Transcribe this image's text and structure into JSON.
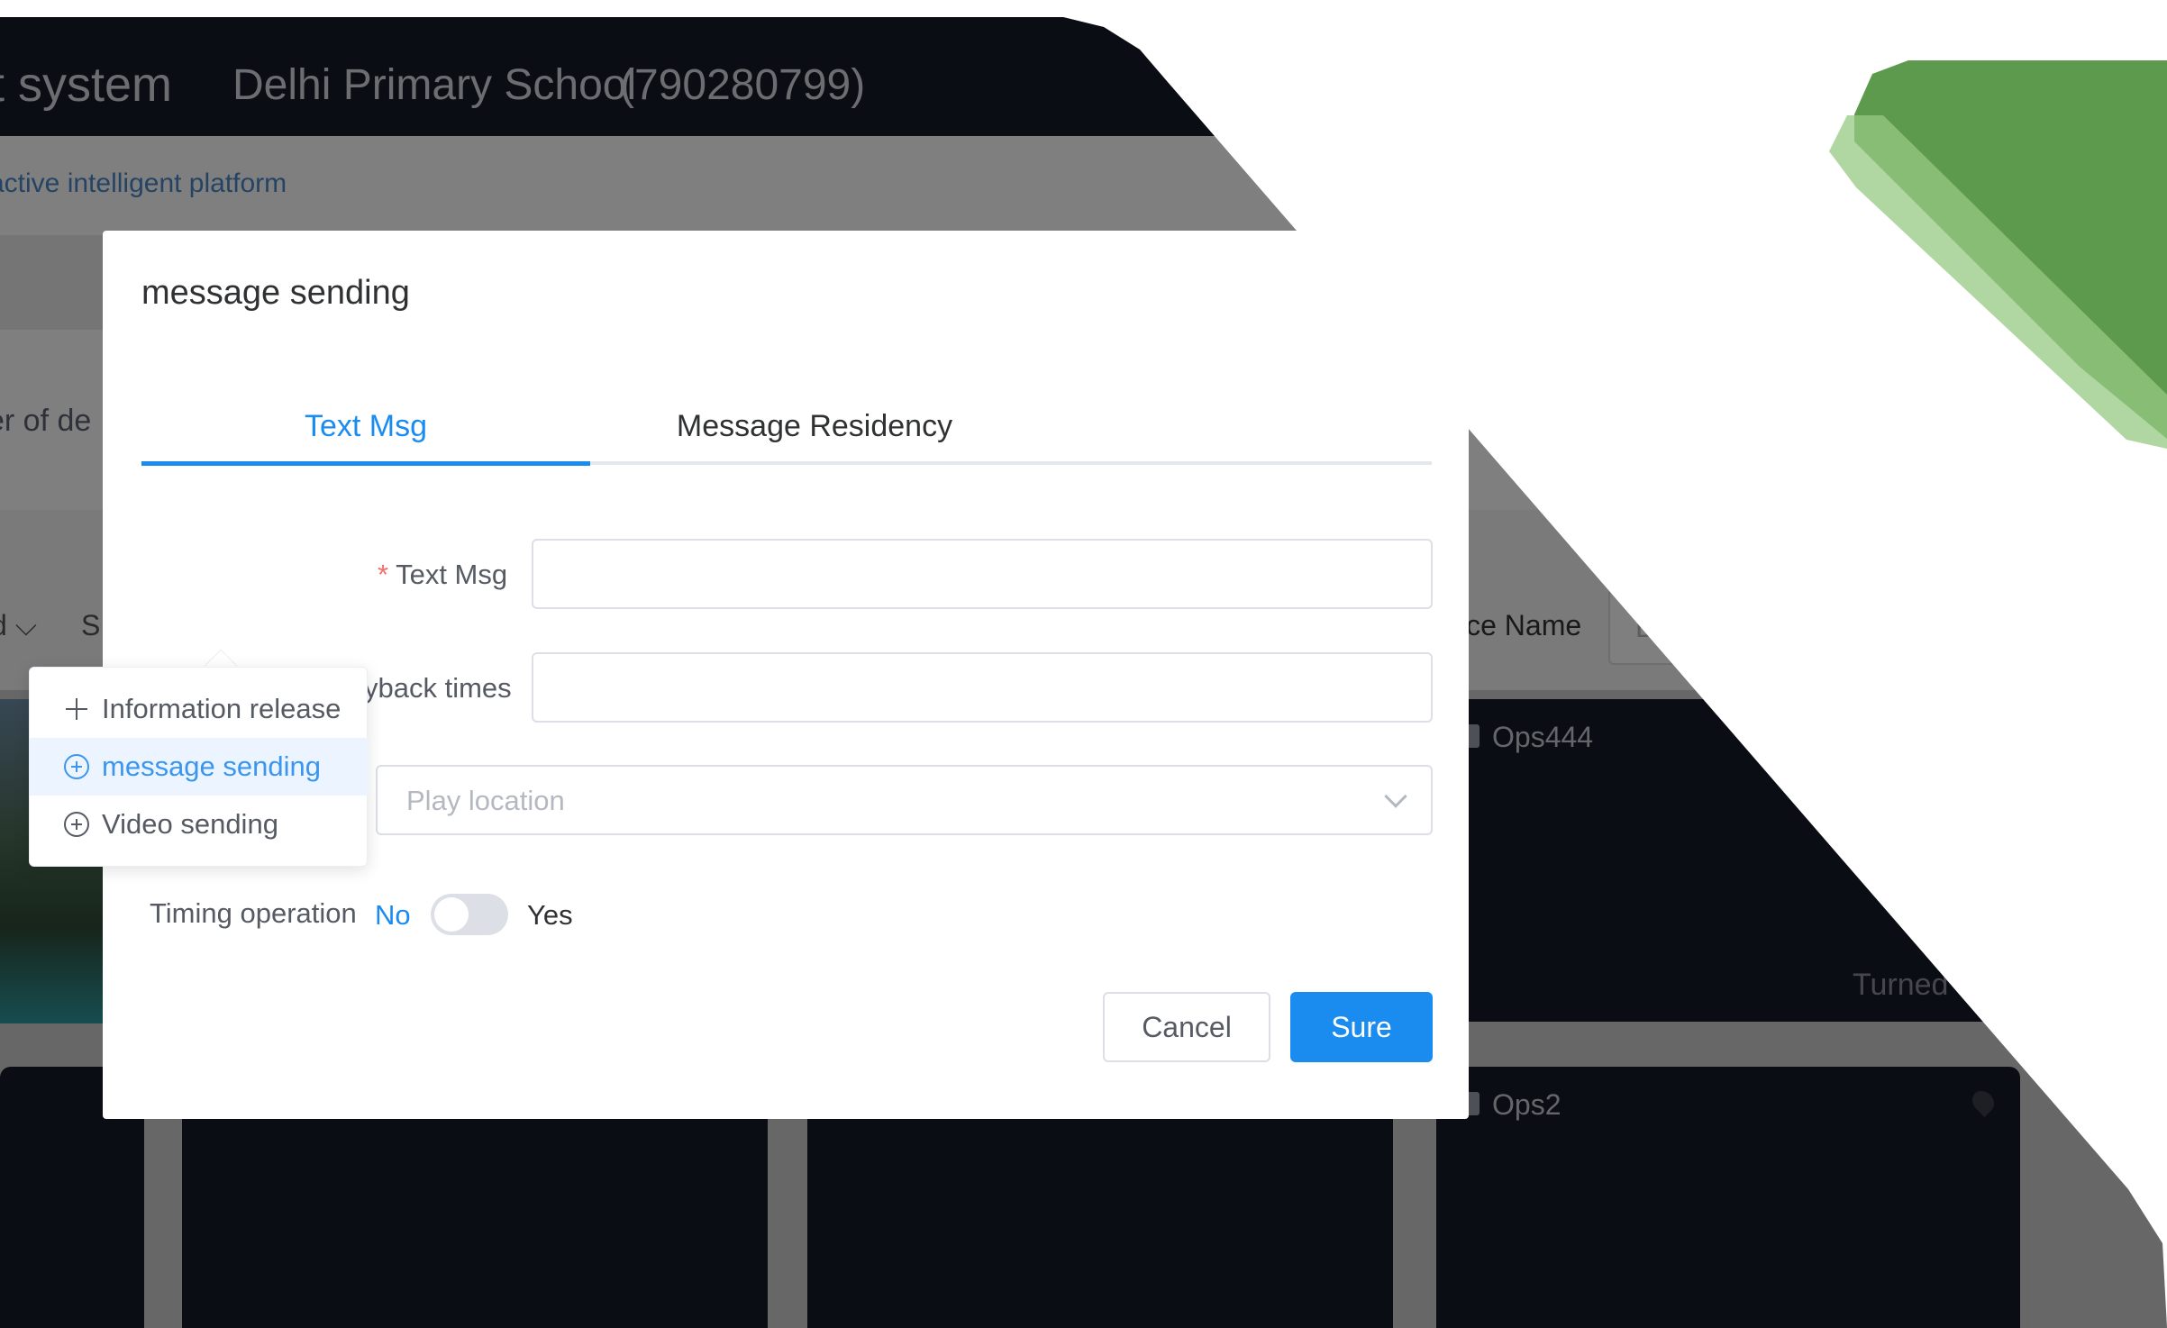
{
  "app": {
    "header_system": "t system",
    "school_name": "Delhi Primary School",
    "school_code": "(790280799)",
    "subtitle": "active intelligent platform",
    "stats_fragment": "er of de",
    "filter_left_fragment": "d",
    "filter_s_fragment": "S",
    "filter_device_name_label": "ice Name",
    "filter_device_name_placeholder": "D"
  },
  "devices": [
    {
      "name": "Ops444",
      "status": "Turned O"
    },
    {
      "name": "Ops2"
    }
  ],
  "modal": {
    "title": "message sending",
    "tabs": [
      {
        "label": "Text Msg",
        "active": true
      },
      {
        "label": "Message Residency",
        "active": false
      }
    ],
    "form": {
      "text_msg_label": "Text Msg",
      "required_mark": "*",
      "text_msg_value": "",
      "playback_label": "yback times",
      "playback_value": "",
      "location_placeholder": "Play location",
      "timing_label": "Timing operation",
      "timing_no": "No",
      "timing_yes": "Yes",
      "timing_enabled": false
    },
    "buttons": {
      "cancel": "Cancel",
      "sure": "Sure"
    }
  },
  "dropdown": {
    "items": [
      {
        "label": "Information release",
        "icon": "plus-icon"
      },
      {
        "label": "message sending",
        "icon": "circle-plus-icon",
        "active": true
      },
      {
        "label": "Video sending",
        "icon": "circle-plus-icon"
      }
    ]
  },
  "colors": {
    "accent": "#1a8cf0",
    "header_bg": "#161b28",
    "green_dark": "#5d9a4d",
    "green_light": "#96c882",
    "required": "#f56c6c"
  }
}
